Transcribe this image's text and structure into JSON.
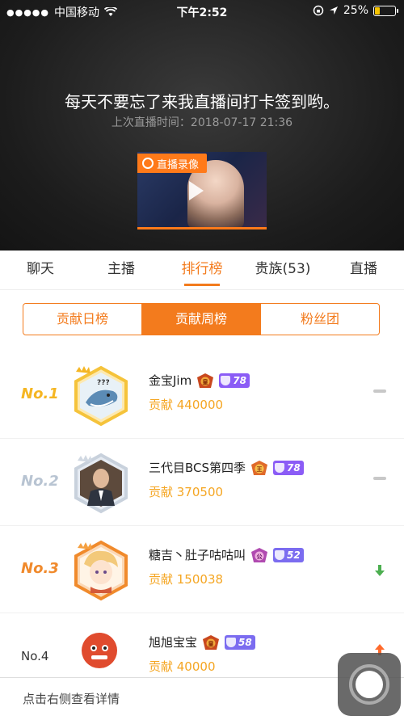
{
  "status_bar": {
    "carrier": "中国移动",
    "time": "下午2:52",
    "battery": "25%",
    "battery_level": 0.25
  },
  "hero": {
    "message": "每天不要忘了来我直播间打卡签到哟。",
    "last_live": "上次直播时间：2018-07-17 21:36",
    "replay_tag": "直播录像"
  },
  "tabs": [
    {
      "label": "聊天"
    },
    {
      "label": "主播"
    },
    {
      "label": "排行榜"
    },
    {
      "label": "贵族(53)"
    },
    {
      "label": "直播"
    }
  ],
  "active_tab": "排行榜",
  "segments": [
    {
      "label": "贡献日榜"
    },
    {
      "label": "贡献周榜"
    },
    {
      "label": "粉丝团"
    }
  ],
  "active_segment": "贡献周榜",
  "ranking": [
    {
      "rank": "No.1",
      "name": "金宝Jim",
      "contribution": "贡献  440000",
      "level": "78",
      "trend": "same"
    },
    {
      "rank": "No.2",
      "name": "三代目BCS第四季",
      "contribution": "贡献  370500",
      "level": "78",
      "trend": "same"
    },
    {
      "rank": "No.3",
      "name": "糖吉丶肚子咕咕叫",
      "contribution": "贡献  150038",
      "level": "52",
      "trend": "down"
    },
    {
      "rank": "No.4",
      "name": "旭旭宝宝",
      "contribution": "贡献  40000",
      "level": "58",
      "trend": "up"
    }
  ],
  "footer": {
    "hint": "点击右侧查看详情"
  },
  "colors": {
    "accent": "#f37b1d",
    "gold": "#f5a623",
    "level_badge": "#8b5cf6",
    "trend_down": "#4caf50",
    "trend_up": "#ff6a2b"
  }
}
